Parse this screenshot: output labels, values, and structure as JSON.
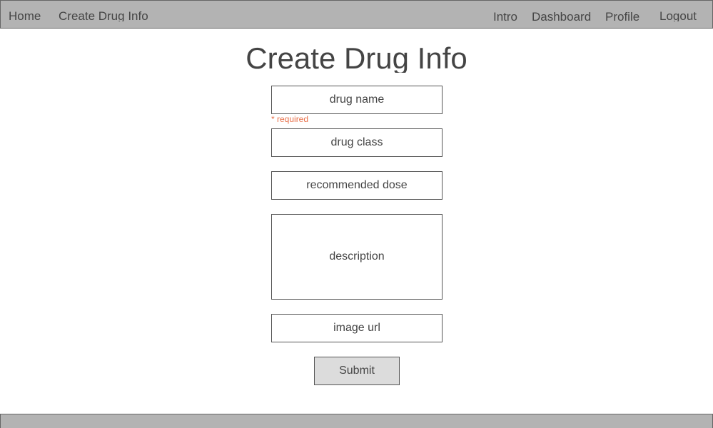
{
  "navbar": {
    "left_links": [
      {
        "label": "Home"
      },
      {
        "label": "Create Drug Info"
      }
    ],
    "right_links": [
      {
        "label": "Intro"
      },
      {
        "label": "Dashboard"
      },
      {
        "label": "Profile"
      },
      {
        "label": "Logout"
      }
    ]
  },
  "page": {
    "title": "Create Drug Info"
  },
  "form": {
    "drug_name": {
      "placeholder": "drug name",
      "value": ""
    },
    "required_note": "* required",
    "drug_class": {
      "placeholder": "drug class",
      "value": ""
    },
    "recommended_dose": {
      "placeholder": "recommended dose",
      "value": ""
    },
    "description": {
      "placeholder": "description",
      "value": ""
    },
    "image_url": {
      "placeholder": "image url",
      "value": ""
    },
    "submit_label": "Submit"
  },
  "colors": {
    "navbar_background": "#b3b3b3",
    "required_text": "#e8704a",
    "submit_background": "#dcdcdc"
  }
}
